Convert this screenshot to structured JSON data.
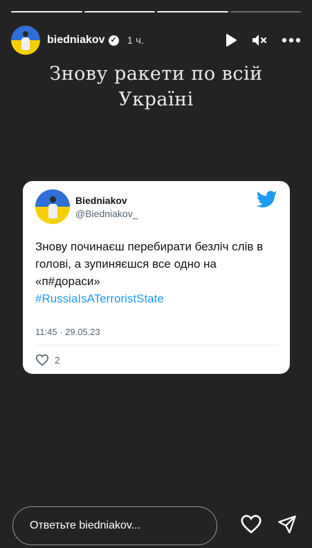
{
  "progress": {
    "segments": 4,
    "completed": 3
  },
  "header": {
    "username": "biedniakov",
    "verified_icon": "verified-badge-icon",
    "time": "1 ч."
  },
  "caption": {
    "line1": "Знову ракети по всій",
    "line2": "Україні"
  },
  "tweet": {
    "name": "Biedniakov",
    "handle": "@Biedniakov_",
    "text": "Знову починаєш перебирати безліч слів в голові, а зупиняєшся все одно на «п#дораси»",
    "hashtag": "#RussiaIsATerroristState",
    "date": "11:45 · 29.05.23",
    "likes": "2",
    "colors": {
      "hashtag": "#1d9bf0",
      "bird": "#1d9bf0"
    }
  },
  "reply": {
    "placeholder": "Ответьте biedniakov..."
  },
  "icons": {
    "play": "play-icon",
    "mute": "mute-icon",
    "more": "more-icon",
    "heart": "heart-icon",
    "send": "send-icon",
    "bird": "twitter-bird-icon"
  }
}
